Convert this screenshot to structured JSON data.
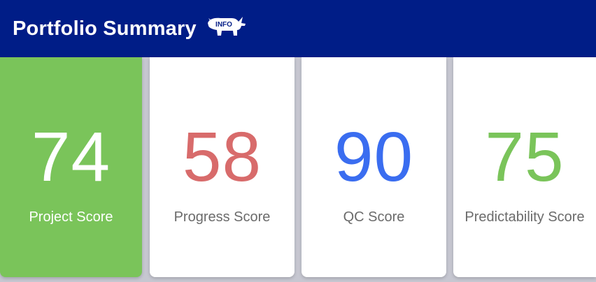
{
  "header": {
    "title": "Portfolio Summary",
    "logo_text": "INFO",
    "logo_icon": "rhino-icon",
    "background": "#001d87"
  },
  "cards": [
    {
      "value": "74",
      "label": "Project Score",
      "value_color": "#ffffff",
      "background": "#7ac45a"
    },
    {
      "value": "58",
      "label": "Progress Score",
      "value_color": "#d86b6b",
      "background": "#ffffff"
    },
    {
      "value": "90",
      "label": "QC Score",
      "value_color": "#3a6df0",
      "background": "#ffffff"
    },
    {
      "value": "75",
      "label": "Predictability Score",
      "value_color": "#7ac45a",
      "background": "#ffffff"
    }
  ]
}
